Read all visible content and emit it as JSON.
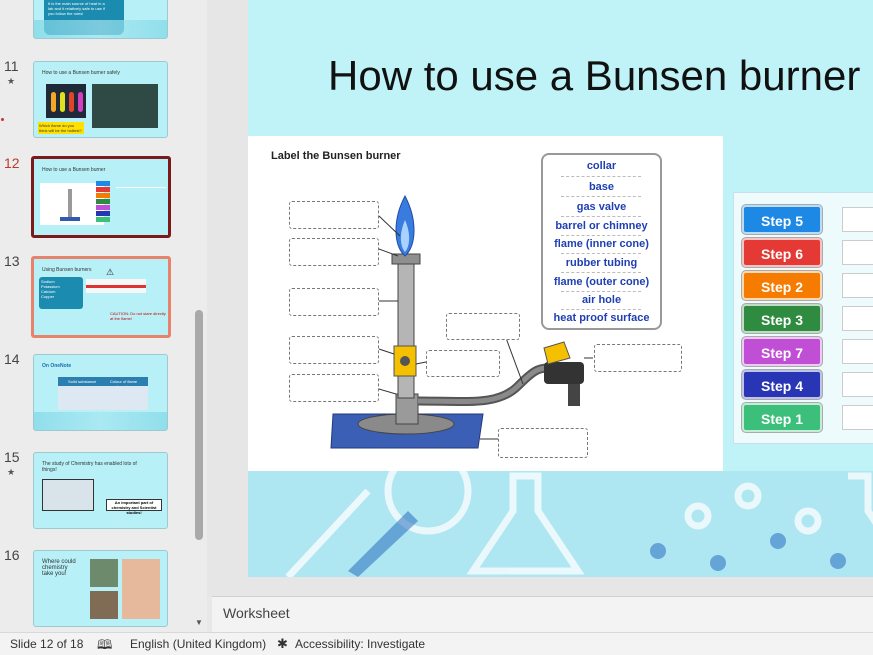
{
  "thumbnails": [
    {
      "num": "",
      "title": "It is the main source of heat in a lab and it relatively safe to use if you follow the rules!",
      "star": false
    },
    {
      "num": "11",
      "title": "How to use a Bunsen burner safely",
      "star": true,
      "caption": "Which flame do you think will be the hottest?"
    },
    {
      "num": "12",
      "title": "How to use a Bunsen burner",
      "star": false,
      "active": true
    },
    {
      "num": "13",
      "title": "Using Bunsen burners",
      "star": false,
      "list": [
        "Sodium",
        "Potassium",
        "Calcium",
        "Copper"
      ],
      "caution": "CAUTION: Do not stare directly at the flame!"
    },
    {
      "num": "14",
      "title": "On OneNote",
      "star": false,
      "cols": [
        "Solid substance",
        "Colour of flame produced"
      ]
    },
    {
      "num": "15",
      "title": "The study of Chemistry has enabled lots of things!",
      "star": true,
      "note": "An important part of chemistry and Scientist studies!"
    },
    {
      "num": "16",
      "title": "Where could chemistry take you!",
      "star": false
    }
  ],
  "slide": {
    "title": "How to use a Bunsen burner",
    "worksheet_title": "Label the Bunsen burner",
    "word_bank": [
      "collar",
      "base",
      "gas valve",
      "barrel or  chimney",
      "flame (inner cone)",
      "rubber tubing",
      "flame (outer cone)",
      "air hole",
      "heat proof surface"
    ],
    "steps": [
      {
        "label": "Step 5",
        "color": "#1e88e5"
      },
      {
        "label": "Step 6",
        "color": "#e53935"
      },
      {
        "label": "Step 2",
        "color": "#f57c00"
      },
      {
        "label": "Step 3",
        "color": "#2e8b40"
      },
      {
        "label": "Step 7",
        "color": "#c04fd6"
      },
      {
        "label": "Step 4",
        "color": "#2836b5"
      },
      {
        "label": "Step 1",
        "color": "#3cbf7a"
      }
    ]
  },
  "notes": {
    "placeholder": "Worksheet"
  },
  "status": {
    "slide": "Slide 12 of 18",
    "language": "English (United Kingdom)",
    "accessibility": "Accessibility: Investigate"
  }
}
